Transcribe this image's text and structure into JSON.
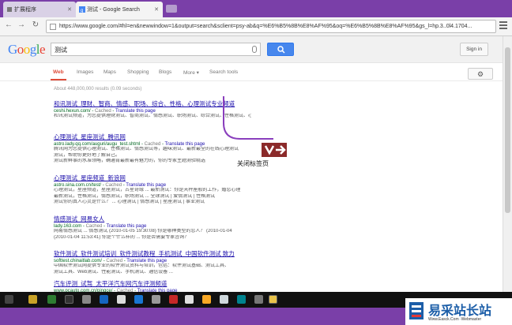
{
  "browser": {
    "tabs": [
      {
        "label": "扩展程序"
      },
      {
        "label": "测试 - Google Search"
      }
    ],
    "url": "https://www.google.com/#hl=en&newwindow=1&output=search&sclient=psy-ab&q=%E6%B5%8B%E8%AF%95&oq=%E6%B5%8B%E8%AF%95&gs_l=hp.3..0l4.1704..."
  },
  "google": {
    "query": "测试",
    "signin_label": "Sign in",
    "nav": [
      "Web",
      "Images",
      "Maps",
      "Shopping",
      "Blogs",
      "More ▾",
      "Search tools"
    ],
    "stats": "About 448,000,000 results (0.09 seconds)"
  },
  "results": [
    {
      "title": "和讯测试_理财、智商、情感、职场、综合、性格、心理测试专业频道",
      "url": "ceshi.hexun.com/",
      "cache": "Cached",
      "translate": "Translate this page",
      "snippet": [
        "和讯测试频道，为您提供理财测试、智商测试、情感测试、职场测试、综合测试、性格测试、心理测试等专业测试服务。"
      ]
    },
    {
      "title": "心理测试_星座测试_腾讯网",
      "url": "astro.lady.qq.com/auguri/augu_test.shtml",
      "cache": "Cached",
      "translate": "Translate this page",
      "snippet": [
        "腾讯网为您提供心理测试、性格测试、情感测试等，趣味测试、最新最全的在线心理测试",
        "测试，帮助你更好地了解自己。",
        "测试新鲜事的水准领略，确通宵最新最有魅力的，你的专家主题测验精选"
      ]
    },
    {
      "title": "心理测试_星座频道_新浪网",
      "url": "astro.sina.com.cn/test/",
      "cache": "Cached",
      "translate": "Translate this page",
      "snippet": [
        "心理测试，星座频道，星座测试，占星奇缘 ... 最新测试：你是天秤座般的工作，婚恋心理",
        "最新测试，性格测试，情感测试，职场测试 ... 全球测试 | 爱情测试 | 性格测试",
        "测试你的真人心灵是什么？ ... 心理测试 | 情感测试 | 星座测试 | 事业测试"
      ]
    },
    {
      "title": "情感测试_网易女人",
      "url": "lady.163.com",
      "cache": "Cached",
      "translate": "Translate this page",
      "snippet": [
        "网易情感测试 ... 情感测试 (2010-01-05 19:30:08) 你是哪种类型的恋人？ (2010-01-04",
        "(2010-01-04 11:53:41) 你是个什么样的 ... 你是否需要专家咨询？"
      ]
    },
    {
      "title": "软件测试_软件测试培训_软件测试教程_手机测试_中国软件测试 致力",
      "url": "softtest.chinaitlab.com/",
      "cache": "Cached",
      "translate": "Translate this page",
      "snippet": [
        "中国软件测试网提供专业的软件测试资料与培训，包括：软件测试基础、测试工具、",
        "测试工具、Web测试、性能测试、手机测试、通信设备 ..."
      ]
    },
    {
      "title": "汽车评测_试驾_太平洋汽车网汽车评测频道",
      "url": "www.pcauto.com.cn/pingce/",
      "cache": "Cached",
      "translate": "Translate this page",
      "snippet": []
    }
  ],
  "annotation": {
    "label": "关闭标签页"
  },
  "watermark": {
    "title": "易采站长站",
    "subtitle": "Www.Easck.Com  ·Webmaster"
  },
  "colors": {
    "frame": "#7a3fa8",
    "link": "#1a0dab",
    "url_green": "#006621",
    "highlight": "#dd4b39",
    "annotation": "#8b2a2a"
  }
}
